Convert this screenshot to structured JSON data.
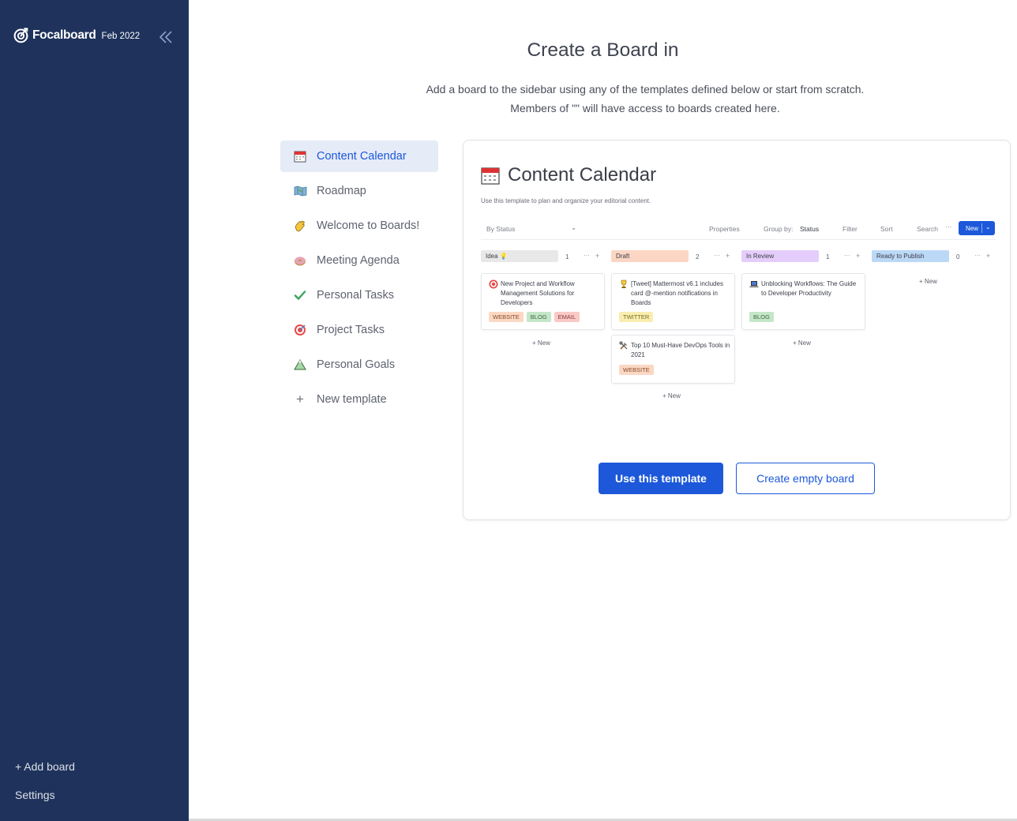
{
  "sidebar": {
    "brand_name": "Focalboard",
    "version": "Feb 2022",
    "add_board": "+ Add board",
    "settings": "Settings"
  },
  "header": {
    "title": "Create a Board in",
    "subtitle_line1": "Add a board to the sidebar using any of the templates defined below or start from scratch.",
    "subtitle_line2": "Members of \"\" will have access to boards created here."
  },
  "templates": [
    {
      "label": "Content Calendar",
      "icon": "calendar-icon",
      "active": true
    },
    {
      "label": "Roadmap",
      "icon": "map-icon"
    },
    {
      "label": "Welcome to Boards!",
      "icon": "waving-hand-icon"
    },
    {
      "label": "Meeting Agenda",
      "icon": "donut-icon"
    },
    {
      "label": "Personal Tasks",
      "icon": "check-icon"
    },
    {
      "label": "Project Tasks",
      "icon": "target-icon"
    },
    {
      "label": "Personal Goals",
      "icon": "mountain-icon"
    },
    {
      "label": "New template",
      "icon": "plus-icon"
    }
  ],
  "preview": {
    "title": "Content Calendar",
    "description": "Use this template to plan and organize your editorial content.",
    "view_name": "By Status",
    "properties": "Properties",
    "group_by_label": "Group by:",
    "group_by_value": "Status",
    "filter": "Filter",
    "sort": "Sort",
    "search": "Search",
    "more": "···",
    "new_button": "New",
    "columns": [
      {
        "label": "Idea",
        "count": "1",
        "color": "#e8e8e8"
      },
      {
        "label": "Draft",
        "count": "2",
        "color": "#fcd6c4"
      },
      {
        "label": "In Review",
        "count": "1",
        "color": "#e4cdfa"
      },
      {
        "label": "Ready to Publish",
        "count": "0",
        "color": "#bcd8f7"
      }
    ],
    "cards": [
      {
        "title": "New Project and Workflow Management Solutions for Developers",
        "emoji": "target-icon",
        "tags": [
          "WEBSITE",
          "BLOG",
          "EMAIL"
        ]
      },
      {
        "title": "[Tweet] Mattermost v6.1 includes card @-mention notifications in Boards",
        "emoji": "trophy-icon",
        "tags": [
          "TWITTER"
        ]
      },
      {
        "title": "Top 10 Must-Have DevOps Tools in 2021",
        "emoji": "tools-icon",
        "tags": [
          "WEBSITE"
        ]
      },
      {
        "title": "Unblocking Workflows: The Guide to Developer Productivity",
        "emoji": "laptop-icon",
        "tags": [
          "BLOG"
        ]
      }
    ],
    "col_new": "+ New",
    "use_template": "Use this template",
    "create_empty": "Create empty board"
  }
}
